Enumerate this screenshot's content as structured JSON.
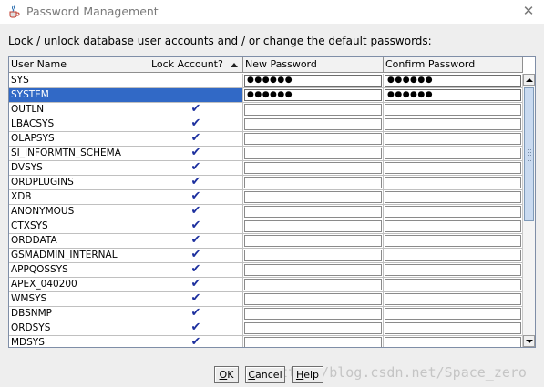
{
  "window": {
    "title": "Password Management",
    "close_glyph": "✕",
    "icon": "java-cup-icon"
  },
  "instruction": "Lock / unlock database user accounts and / or change the default passwords:",
  "table": {
    "columns": [
      "User Name",
      "Lock Account?",
      "New Password",
      "Confirm Password"
    ],
    "sort_column": "Lock Account?",
    "sort_direction": "ascending",
    "rows": [
      {
        "user": "SYS",
        "locked": false,
        "new_password": "●●●●●●",
        "confirm_password": "●●●●●●",
        "selected": false
      },
      {
        "user": "SYSTEM",
        "locked": false,
        "new_password": "●●●●●●",
        "confirm_password": "●●●●●●",
        "selected": true
      },
      {
        "user": "OUTLN",
        "locked": true,
        "new_password": "",
        "confirm_password": "",
        "selected": false
      },
      {
        "user": "LBACSYS",
        "locked": true,
        "new_password": "",
        "confirm_password": "",
        "selected": false
      },
      {
        "user": "OLAPSYS",
        "locked": true,
        "new_password": "",
        "confirm_password": "",
        "selected": false
      },
      {
        "user": "SI_INFORMTN_SCHEMA",
        "locked": true,
        "new_password": "",
        "confirm_password": "",
        "selected": false
      },
      {
        "user": "DVSYS",
        "locked": true,
        "new_password": "",
        "confirm_password": "",
        "selected": false
      },
      {
        "user": "ORDPLUGINS",
        "locked": true,
        "new_password": "",
        "confirm_password": "",
        "selected": false
      },
      {
        "user": "XDB",
        "locked": true,
        "new_password": "",
        "confirm_password": "",
        "selected": false
      },
      {
        "user": "ANONYMOUS",
        "locked": true,
        "new_password": "",
        "confirm_password": "",
        "selected": false
      },
      {
        "user": "CTXSYS",
        "locked": true,
        "new_password": "",
        "confirm_password": "",
        "selected": false
      },
      {
        "user": "ORDDATA",
        "locked": true,
        "new_password": "",
        "confirm_password": "",
        "selected": false
      },
      {
        "user": "GSMADMIN_INTERNAL",
        "locked": true,
        "new_password": "",
        "confirm_password": "",
        "selected": false
      },
      {
        "user": "APPQOSSYS",
        "locked": true,
        "new_password": "",
        "confirm_password": "",
        "selected": false
      },
      {
        "user": "APEX_040200",
        "locked": true,
        "new_password": "",
        "confirm_password": "",
        "selected": false
      },
      {
        "user": "WMSYS",
        "locked": true,
        "new_password": "",
        "confirm_password": "",
        "selected": false
      },
      {
        "user": "DBSNMP",
        "locked": true,
        "new_password": "",
        "confirm_password": "",
        "selected": false
      },
      {
        "user": "ORDSYS",
        "locked": true,
        "new_password": "",
        "confirm_password": "",
        "selected": false
      },
      {
        "user": "MDSYS",
        "locked": true,
        "new_password": "",
        "confirm_password": "",
        "selected": false
      }
    ],
    "check_glyph": "✔"
  },
  "buttons": {
    "ok": {
      "mnemonic": "O",
      "rest": "K"
    },
    "cancel": {
      "mnemonic": "C",
      "rest": "ancel"
    },
    "help": {
      "mnemonic": "H",
      "rest": "elp"
    }
  },
  "watermark": "http://blog.csdn.net/Space_zero",
  "colors": {
    "selection": "#3169c6",
    "check": "#1c2f9e",
    "dialog_bg": "#eeeeee"
  }
}
